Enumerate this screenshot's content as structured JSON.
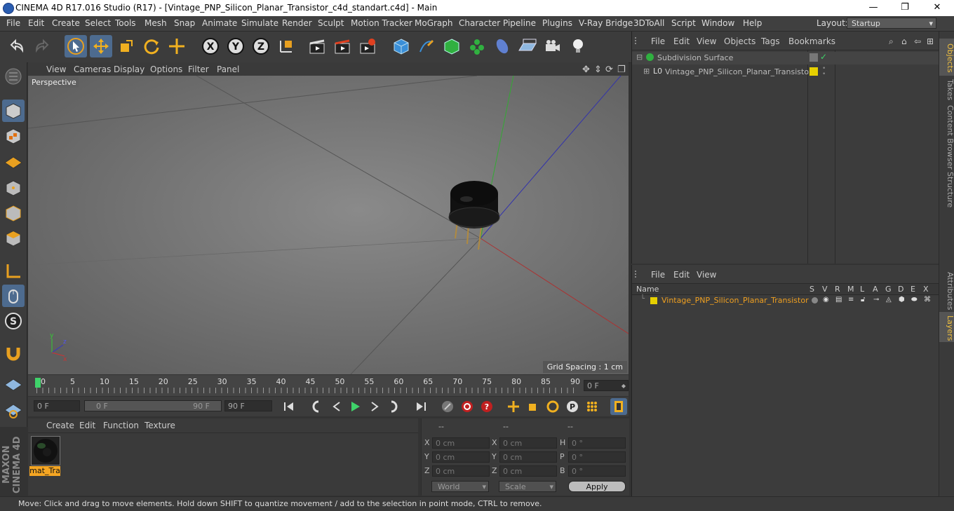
{
  "window": {
    "title": "CINEMA 4D R17.016 Studio (R17) - [Vintage_PNP_Silicon_Planar_Transistor_c4d_standart.c4d] - Main",
    "controls": [
      "—",
      "❐",
      "✕"
    ]
  },
  "menubar": {
    "items": [
      "File",
      "Edit",
      "Create",
      "Select",
      "Tools",
      "Mesh",
      "Snap",
      "Animate",
      "Simulate",
      "Render",
      "Sculpt",
      "Motion Tracker",
      "MoGraph",
      "Character",
      "Pipeline",
      "Plugins",
      "V-Ray Bridge",
      "3DToAll",
      "Script",
      "Window",
      "Help"
    ],
    "layout_label": "Layout:",
    "layout_value": "Startup"
  },
  "viewport": {
    "menu": [
      "View",
      "Cameras",
      "Display",
      "Options",
      "Filter",
      "Panel"
    ],
    "label": "Perspective",
    "grid_spacing": "Grid Spacing : 1 cm"
  },
  "timeline": {
    "ticks": [
      "0",
      "5",
      "10",
      "15",
      "20",
      "25",
      "30",
      "35",
      "40",
      "45",
      "50",
      "55",
      "60",
      "65",
      "70",
      "75",
      "80",
      "85",
      "90"
    ],
    "current_frame": "0 F"
  },
  "transport": {
    "start_field": "0 F",
    "range_start": "0 F",
    "range_end": "90 F",
    "end_field": "90 F"
  },
  "material_manager": {
    "menu": [
      "Create",
      "Edit",
      "Function",
      "Texture"
    ],
    "materials": [
      {
        "name": "mat_Tra"
      }
    ]
  },
  "coordinates": {
    "headers": [
      "--",
      "--",
      "--"
    ],
    "rows": [
      {
        "l1": "X",
        "v1": "0 cm",
        "l2": "X",
        "v2": "0 cm",
        "l3": "H",
        "v3": "0 °"
      },
      {
        "l1": "Y",
        "v1": "0 cm",
        "l2": "Y",
        "v2": "0 cm",
        "l3": "P",
        "v3": "0 °"
      },
      {
        "l1": "Z",
        "v1": "0 cm",
        "l2": "Z",
        "v2": "0 cm",
        "l3": "B",
        "v3": "0 °"
      }
    ],
    "space": "World",
    "mode": "Scale",
    "apply_label": "Apply"
  },
  "object_manager": {
    "menu": [
      "File",
      "Edit",
      "View",
      "Objects",
      "Tags",
      "Bookmarks"
    ],
    "objects": [
      {
        "name": "Subdivision Surface"
      },
      {
        "name": "Vintage_PNP_Silicon_Planar_Transistor"
      }
    ]
  },
  "layer_manager": {
    "menu": [
      "File",
      "Edit",
      "View"
    ],
    "columns": [
      "Name",
      "S",
      "V",
      "R",
      "M",
      "L",
      "A",
      "G",
      "D",
      "E",
      "X"
    ],
    "layers": [
      {
        "name": "Vintage_PNP_Silicon_Planar_Transistor"
      }
    ]
  },
  "right_tabs": [
    "Objects",
    "Takes",
    "Content Browser",
    "Structure",
    "Attributes",
    "Layers"
  ],
  "status": "Move: Click and drag to move elements. Hold down SHIFT to quantize movement / add to the selection in point mode, CTRL to remove.",
  "colors": {
    "accent": "#4d6b8f",
    "layer_yellow": "#e6d000",
    "material_orange": "#f5a623"
  }
}
